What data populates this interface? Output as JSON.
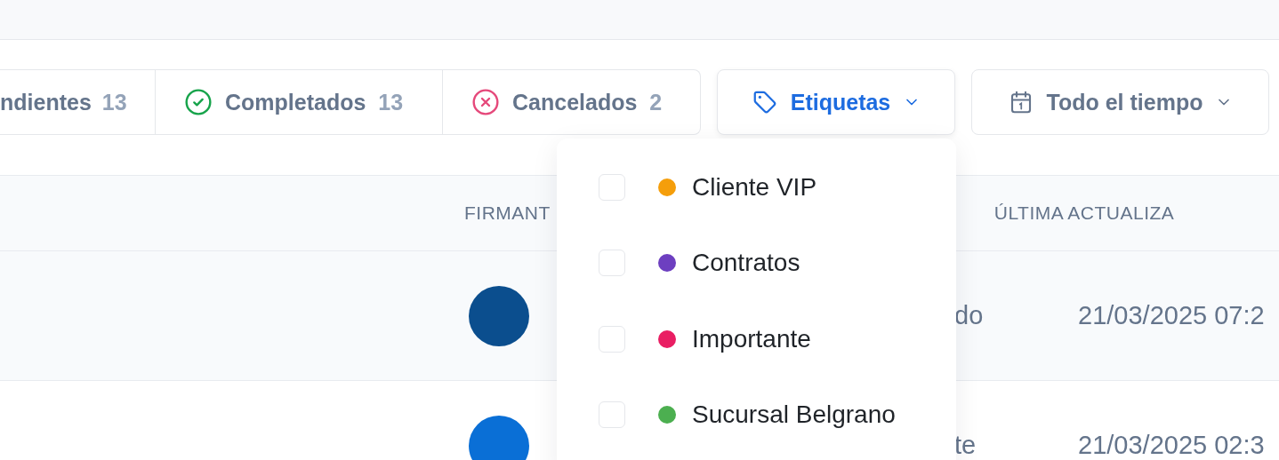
{
  "filters": {
    "status_tabs": [
      {
        "kind": "pending",
        "label": "ndientes",
        "count": "13",
        "selected": false
      },
      {
        "kind": "completed",
        "label": "Completados",
        "count": "13",
        "selected": false
      },
      {
        "kind": "cancelled",
        "label": "Cancelados",
        "count": "2",
        "selected": false
      }
    ],
    "tags_button": {
      "label": "Etiquetas",
      "open": true
    },
    "date_button": {
      "label": "Todo el tiempo"
    }
  },
  "table": {
    "columns": [
      {
        "label": "FIRMANT"
      },
      {
        "label": "ÚLTIMA ACTUALIZA"
      }
    ],
    "rows": [
      {
        "hovered": true,
        "avatar": {
          "color": "#0b4e8e"
        },
        "column_3": "do",
        "updated": "21/03/2025 07:2"
      },
      {
        "hovered": false,
        "avatar": {
          "color": "#0a6fd6"
        },
        "column_3": "te",
        "updated": "21/03/2025 02:3"
      }
    ]
  },
  "tag_menu": {
    "items": [
      {
        "label": "Cliente VIP",
        "color": "#f59e0b",
        "checked": false
      },
      {
        "label": "Contratos",
        "color": "#6d3fc0",
        "checked": false
      },
      {
        "label": "Importante",
        "color": "#e91e63",
        "checked": false
      },
      {
        "label": "Sucursal Belgrano",
        "color": "#4caf50",
        "checked": false
      }
    ]
  }
}
